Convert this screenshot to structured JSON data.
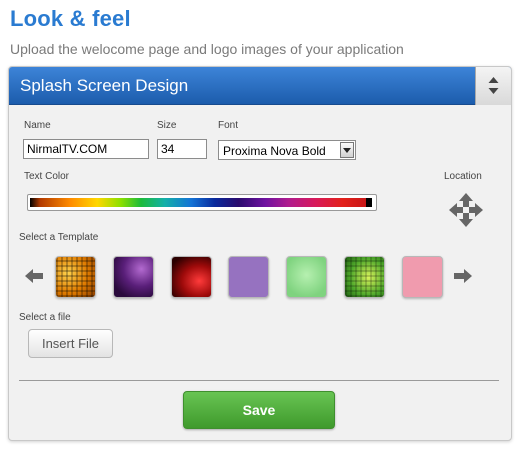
{
  "page": {
    "title": "Look & feel",
    "subtitle": "Upload the welocome page and logo images of your application"
  },
  "panel": {
    "title": "Splash Screen Design"
  },
  "form": {
    "name_label": "Name",
    "name_value": "NirmalTV.COM",
    "size_label": "Size",
    "size_value": "34",
    "font_label": "Font",
    "font_value": "Proxima Nova Bold",
    "text_color_label": "Text Color",
    "location_label": "Location",
    "template_label": "Select a Template",
    "file_label": "Select a file",
    "insert_file_label": "Insert File",
    "save_label": "Save"
  },
  "templates": [
    {
      "name": "template-orange-mosaic",
      "color": "#e07b00"
    },
    {
      "name": "template-purple-abstract",
      "color": "#5a1f7a"
    },
    {
      "name": "template-red-swirl",
      "color": "#9e0a0a"
    },
    {
      "name": "template-lavender",
      "color": "#9672c0"
    },
    {
      "name": "template-light-green",
      "color": "#7fd37f"
    },
    {
      "name": "template-green-mosaic",
      "color": "#4ea82a"
    },
    {
      "name": "template-pink",
      "color": "#f09bae"
    }
  ],
  "icons": {
    "prev": "arrow-left-icon",
    "next": "arrow-right-icon",
    "location": "move-arrows-icon",
    "toggle": "updown-chevron-icon",
    "select": "dropdown-triangle-icon"
  },
  "colors": {
    "accent": "#2a7bd1",
    "header": "#1c5cac",
    "save": "#4aa93a"
  }
}
